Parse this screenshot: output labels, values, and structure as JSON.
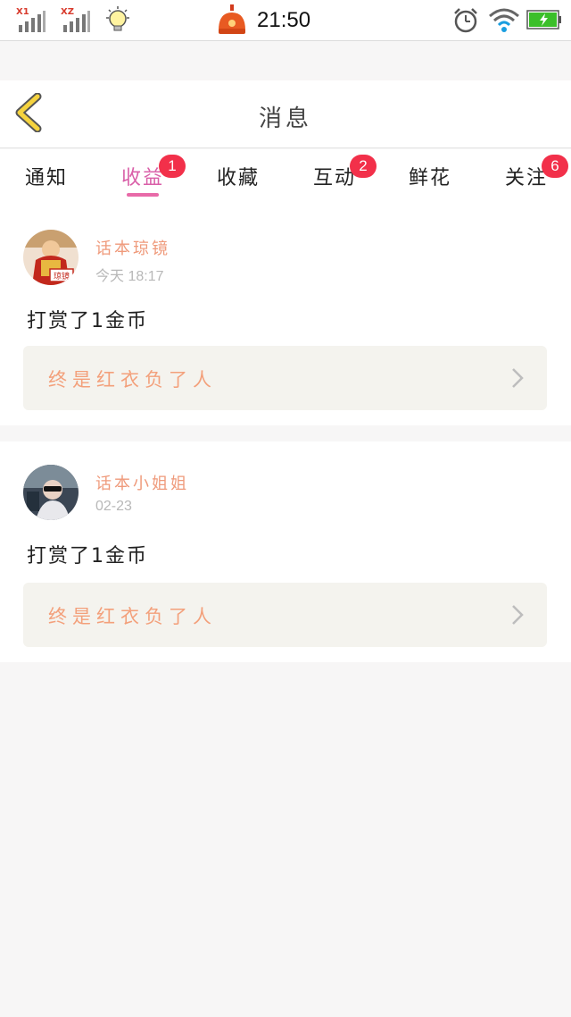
{
  "status_bar": {
    "sim1_label": "X1",
    "sim2_label": "XZ",
    "time": "21:50",
    "icons": [
      "signal-icon",
      "signal-icon",
      "lightbulb-icon",
      "app-icon",
      "alarm-icon",
      "wifi-icon",
      "battery-icon"
    ]
  },
  "header": {
    "title": "消息",
    "back_icon": "chevron-left-icon"
  },
  "tabs": [
    {
      "label": "通知",
      "badge": ""
    },
    {
      "label": "收益",
      "badge": "1",
      "active": true
    },
    {
      "label": "收藏",
      "badge": ""
    },
    {
      "label": "互动",
      "badge": "2"
    },
    {
      "label": "鲜花",
      "badge": ""
    },
    {
      "label": "关注",
      "badge": "6"
    }
  ],
  "messages": [
    {
      "user": "话本琼镜",
      "time": "今天 18:17",
      "text": "打赏了1金币",
      "ref_title": "终是红衣负了人",
      "avatar_caption": "琼镜"
    },
    {
      "user": "话本小姐姐",
      "time": "02-23",
      "text": "打赏了1金币",
      "ref_title": "终是红衣负了人"
    }
  ],
  "colors": {
    "accent": "#e86aa8",
    "badge": "#f2304a",
    "username": "#ef9a7b",
    "ref_title": "#f3a07b",
    "back_icon": "#f5d33f"
  }
}
